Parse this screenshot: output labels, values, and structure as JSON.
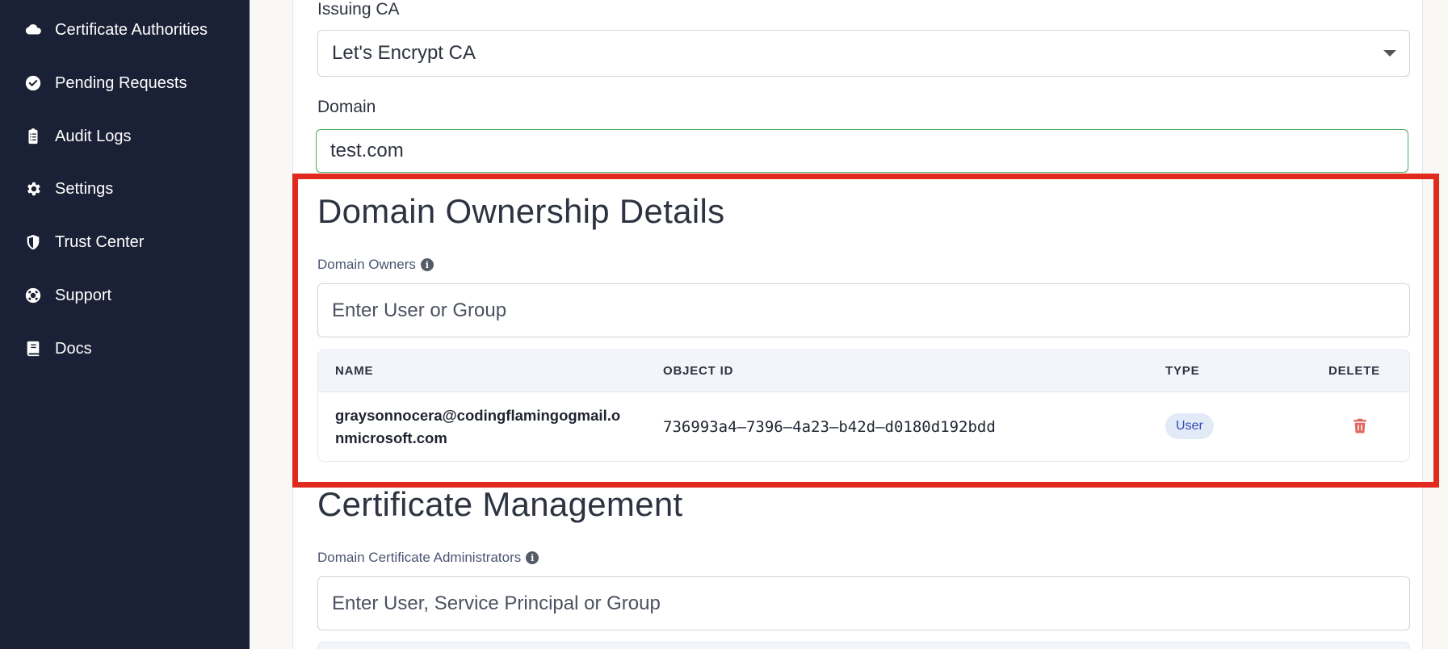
{
  "sidebar": {
    "items": [
      {
        "label": "Certificate Authorities",
        "icon": "cloud-icon"
      },
      {
        "label": "Pending Requests",
        "icon": "check-circle-icon"
      },
      {
        "label": "Audit Logs",
        "icon": "clipboard-icon"
      },
      {
        "label": "Settings",
        "icon": "gear-icon"
      },
      {
        "label": "Trust Center",
        "icon": "shield-icon"
      },
      {
        "label": "Support",
        "icon": "lifebuoy-icon"
      },
      {
        "label": "Docs",
        "icon": "book-icon"
      }
    ]
  },
  "form": {
    "issuing_ca_label": "Issuing CA",
    "issuing_ca_value": "Let's Encrypt CA",
    "domain_label": "Domain",
    "domain_value": "test.com"
  },
  "ownership": {
    "title": "Domain Ownership Details",
    "owners_label": "Domain Owners",
    "owners_placeholder": "Enter User or Group",
    "table": {
      "headers": [
        "NAME",
        "OBJECT ID",
        "TYPE",
        "DELETE"
      ],
      "rows": [
        {
          "name": "graysonnocera@codingflamingogmail.onmicrosoft.com",
          "object_id": "736993a4–7396–4a23–b42d–d0180d192bdd",
          "type": "User"
        }
      ]
    }
  },
  "cert_mgmt": {
    "title": "Certificate Management",
    "admins_label": "Domain Certificate Administrators",
    "admins_placeholder": "Enter User, Service Principal or Group"
  },
  "colors": {
    "sidebar_bg": "#1a2035",
    "highlight": "#e12a1d",
    "valid_border": "#4aa85a",
    "delete": "#e0665f",
    "badge_bg": "#e3eaf7"
  }
}
